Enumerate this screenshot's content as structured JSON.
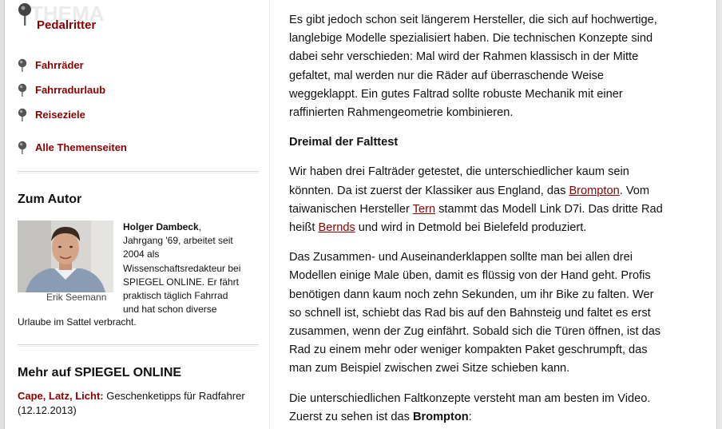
{
  "sidebar": {
    "logo_word": "THEMA",
    "topic_title": "Pedalritter",
    "nav": [
      {
        "label": "Fahrräder"
      },
      {
        "label": "Fahrradurlaub"
      },
      {
        "label": "Reiseziele"
      },
      {
        "label": "Alle Themenseiten"
      }
    ],
    "author_heading": "Zum Autor",
    "author": {
      "name": "Holger Dambeck",
      "bio_lines": [
        ", ",
        "Jahrgang '69, arbeitet seit",
        "2004 als",
        "Wissenschaftsredakteur bei",
        "SPIEGEL ONLINE. Er fährt",
        "praktisch täglich Fahrrad",
        "und hat schon diverse"
      ],
      "bio_last_line": "Urlaube im Sattel verbracht.",
      "photo_credit": "Erik Seemann"
    },
    "more_heading": "Mehr auf SPIEGEL ONLINE",
    "more_links": [
      {
        "title": "Cape, Latz, Licht:",
        "rest": " Geschenketipps für Radfahrer",
        "date": "(12.12.2013)"
      }
    ]
  },
  "article": {
    "p1_lines": [
      "Es gibt jedoch schon seit längerem Hersteller, die sich auf hochwertige,",
      "langlebige Modelle spezialisiert haben. Die technischen Konzepte sind",
      "dabei sehr verschieden: Mal wird der Rahmen klassisch in der Mitte",
      "gefaltet, mal werden nur die Räder auf überraschende Weise",
      "weggeklappt. Ein gutes Faltrad sollte robuste Mechanik mit einer",
      "raffinierten Rahmengeometrie kombinieren."
    ],
    "subheading": "Dreimal der Falttest",
    "p2": {
      "l1": "Wir haben drei Falträder getestet, die unterschiedlicher kaum sein",
      "l2_pre": "könnten. Da ist zuerst der Klassiker aus England, das ",
      "l2_link": "Brompton",
      "l2_post": ". Vom",
      "l3_pre": "taiwanischen Hersteller ",
      "l3_link": "Tern",
      "l3_post": " stammt das Modell Link D7i. Das dritte Rad",
      "l4_pre": "heißt ",
      "l4_link": "Bernds",
      "l4_post": " und wird in Detmold bei Bielefeld produziert."
    },
    "p3_lines": [
      "Das Zusammen- und Auseinanderklappen sollte man bei allen drei",
      "Modellen einige Male üben, damit es flüssig von der Hand geht. Profis",
      "benötigen dann kaum noch zehn Sekunden, um ihr Bike zu falten. Wer",
      "so schnell ist, schiebt das Rad bis auf den Bahnsteig und faltet es erst",
      "zusammen, wenn der Zug einfährt. Sobald sich die Türen öffnen, ist das",
      "Rad zu einem mehr oder weniger kompakten Paket geschrumpft, das",
      "man zum Beispiel zwischen zwei Sitze schieben kann."
    ],
    "p4": {
      "l1": "Die unterschiedlichen Faltkonzepte versteht man am besten im Video.",
      "l2_pre": "Zuerst zu sehen ist das ",
      "l2_bold": "Brompton",
      "l2_post": ":"
    }
  },
  "colors": {
    "accent": "#8b0000",
    "text": "#111111"
  }
}
